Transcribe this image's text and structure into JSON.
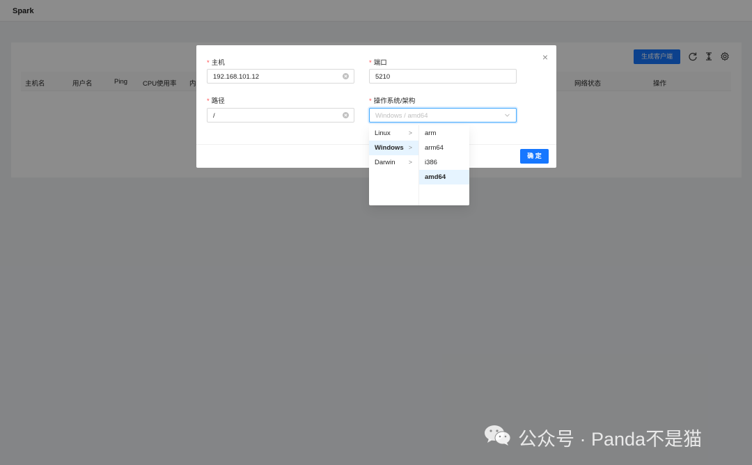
{
  "app": {
    "title": "Spark"
  },
  "toolbar": {
    "generate_label": "生成客户端"
  },
  "table": {
    "columns": [
      "主机名",
      "用户名",
      "Ping",
      "CPU使用率",
      "内",
      "网络状态",
      "操作"
    ]
  },
  "modal": {
    "close_label": "×",
    "host": {
      "label": "主机",
      "value": "192.168.101.12"
    },
    "port": {
      "label": "端口",
      "value": "5210"
    },
    "path": {
      "label": "路径",
      "value": "/"
    },
    "os_arch": {
      "label": "操作系统/架构",
      "placeholder": "Windows / amd64"
    },
    "ok_label": "确 定"
  },
  "cascader": {
    "os_options": [
      {
        "label": "Linux",
        "active": false
      },
      {
        "label": "Windows",
        "active": true
      },
      {
        "label": "Darwin",
        "active": false
      }
    ],
    "arch_options": [
      {
        "label": "arm",
        "active": false
      },
      {
        "label": "arm64",
        "active": false
      },
      {
        "label": "i386",
        "active": false
      },
      {
        "label": "amd64",
        "active": true
      }
    ],
    "arrow": ">"
  },
  "watermark": {
    "text": "公众号 · Panda不是猫",
    "icon": "wechat-icon"
  },
  "colors": {
    "primary": "#1677ff",
    "required": "#ff4d4f",
    "active_bg": "#e6f4ff"
  }
}
